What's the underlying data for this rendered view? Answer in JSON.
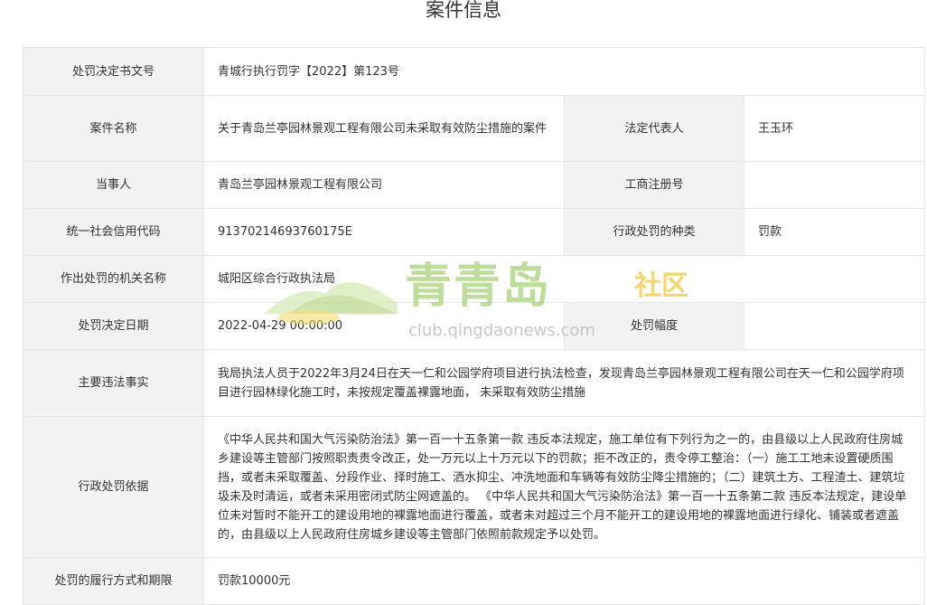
{
  "page": {
    "title": "案件信息"
  },
  "rows": {
    "decision_no": {
      "label": "处罚决定书文号",
      "value": "青城行执行罚字【2022】第123号"
    },
    "case_name": {
      "label": "案件名称",
      "value": "关于青岛兰亭园林景观工程有限公司未采取有效防尘措施的案件"
    },
    "legal_rep": {
      "label": "法定代表人",
      "value": "王玉环"
    },
    "party": {
      "label": "当事人",
      "value": "青岛兰亭园林景观工程有限公司"
    },
    "biz_reg": {
      "label": "工商注册号",
      "value": ""
    },
    "credit_code": {
      "label": "统一社会信用代码",
      "value": "91370214693760175E"
    },
    "penalty_type": {
      "label": "行政处罚的种类",
      "value": "罚款"
    },
    "authority": {
      "label": "作出处罚的机关名称",
      "value": "城阳区综合行政执法局"
    },
    "decision_date": {
      "label": "处罚决定日期",
      "value": "2022-04-29 00:00:00"
    },
    "penalty_range": {
      "label": "处罚幅度",
      "value": ""
    },
    "facts": {
      "label": "主要违法事实",
      "value": "我局执法人员于2022年3月24日在天一仁和公园学府项目进行执法检查，发现青岛兰亭园林景观工程有限公司在天一仁和公园学府项目进行园林绿化施工时，未按规定覆盖裸露地面， 未采取有效防尘措施"
    },
    "basis": {
      "label": "行政处罚依据",
      "value": "《中华人民共和国大气污染防治法》第一百一十五条第一款 违反本法规定，施工单位有下列行为之一的，由县级以上人民政府住房城乡建设等主管部门按照职责责令改正，处一万元以上十万元以下的罚款；拒不改正的，责令停工整治：（一）施工工地未设置硬质围挡，或者未采取覆盖、分段作业、择时施工、洒水抑尘、冲洗地面和车辆等有效防尘降尘措施的；（二）建筑土方、工程渣土、建筑垃圾未及时清运，或者未采用密闭式防尘网遮盖的。 《中华人民共和国大气污染防治法》第一百一十五条第二款 违反本法规定，建设单位未对暂时不能开工的建设用地的裸露地面进行覆盖，或者未对超过三个月不能开工的建设用地的裸露地面进行绿化、铺装或者遮盖的，由县级以上人民政府住房城乡建设等主管部门依照前款规定予以处罚。"
    },
    "execution": {
      "label": "处罚的履行方式和期限",
      "value": "罚款10000元"
    }
  },
  "watermark": {
    "brand": "青青岛",
    "suffix": "社区",
    "url": "club.qingdaonews.com"
  },
  "colors": {
    "label_bg": "#f2f2f2",
    "border": "#e6e6e6",
    "watermark_green": "#a9d27a",
    "watermark_yellow": "#f2c93a"
  }
}
